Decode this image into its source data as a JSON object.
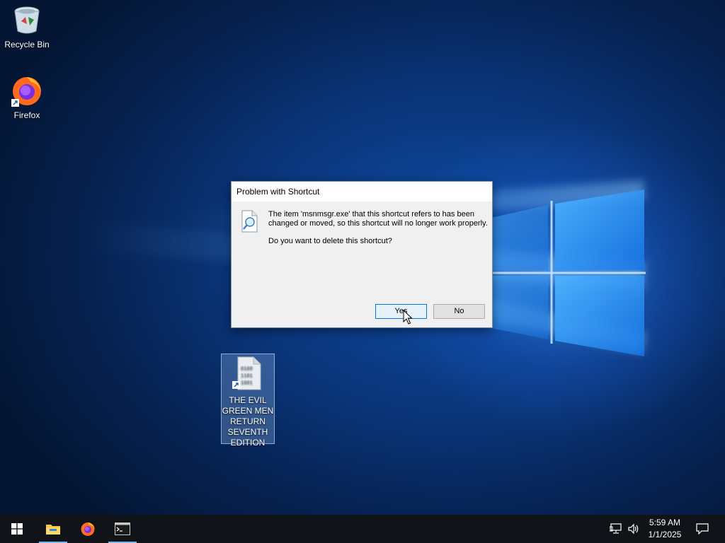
{
  "desktop": {
    "icons": [
      {
        "label": "Recycle Bin",
        "icon": "recycle-bin-icon"
      },
      {
        "label": "Firefox",
        "icon": "firefox-icon"
      },
      {
        "label": "THE EVIL GREEN MEN RETURN SEVENTH EDITION",
        "label_lines": [
          "THE EVIL",
          "GREEN MEN",
          "RETURN",
          "SEVENTH",
          "EDITION"
        ],
        "icon": "binary-file-shortcut-icon",
        "selected": true
      }
    ]
  },
  "dialog": {
    "title": "Problem with Shortcut",
    "message": "The item 'msnmsgr.exe' that this shortcut refers to has been changed or moved, so this shortcut will no longer work properly.",
    "question": "Do you want to delete this shortcut?",
    "yes_label": "Yes",
    "no_label": "No",
    "icon": "shortcut-search-icon"
  },
  "taskbar": {
    "start_icon": "windows-start-icon",
    "pinned": [
      "file-explorer-icon",
      "firefox-icon",
      "command-prompt-icon"
    ],
    "tray_icons": [
      "network-icon",
      "volume-icon"
    ],
    "time": "5:59 AM",
    "date": "1/1/2025",
    "notifications_icon": "action-center-icon"
  },
  "colors": {
    "desktop_blue": "#0a3478",
    "taskbar": "#101318",
    "dialog_bg": "#f0f0f0",
    "focus_border": "#0078d7"
  }
}
